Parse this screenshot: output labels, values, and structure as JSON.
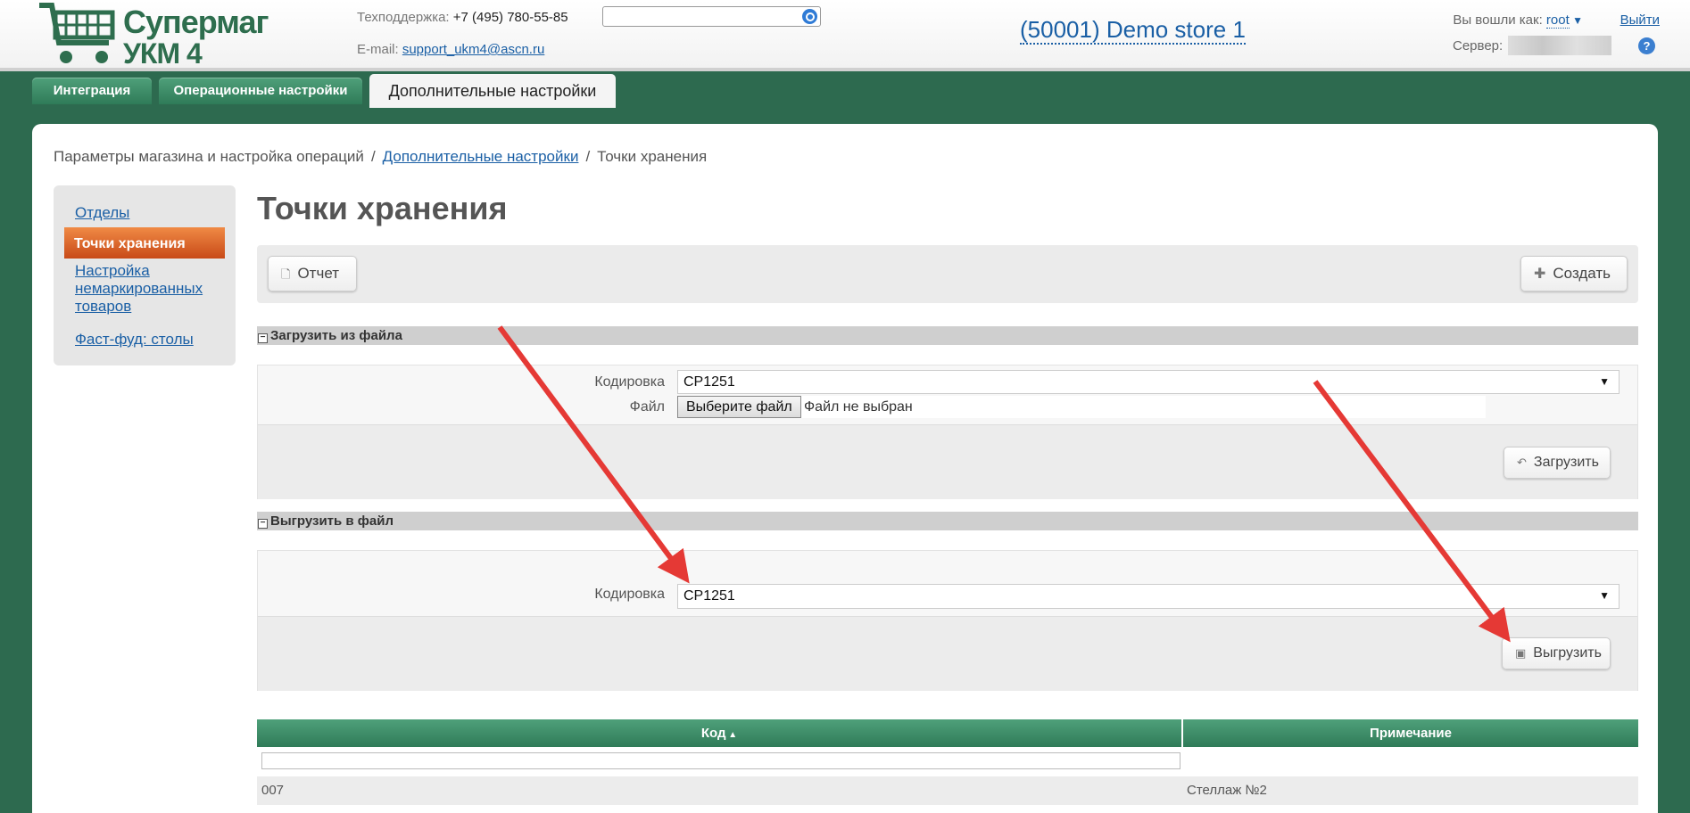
{
  "header": {
    "brand_line1": "Супермаг",
    "brand_line2": "УКМ 4",
    "support_label": "Техподдержка:",
    "support_phone": "+7 (495) 780-55-85",
    "email_label": "E-mail:",
    "email_value": "support_ukm4@ascn.ru",
    "search_value": "",
    "store_name": "(50001) Demo store 1",
    "logged_in_label": "Вы вошли как:",
    "user_name": "root",
    "logout_label": "Выйти",
    "server_label": "Сервер:",
    "help_label": "?"
  },
  "tabs": [
    {
      "label": "Интеграция"
    },
    {
      "label": "Операционные настройки"
    },
    {
      "label": "Дополнительные настройки"
    }
  ],
  "breadcrumb": {
    "root": "Параметры магазина и настройка операций",
    "sep": "/",
    "middle": "Дополнительные настройки",
    "current": "Точки хранения"
  },
  "sidebar": {
    "items": [
      {
        "label": "Отделы"
      },
      {
        "label": "Точки хранения"
      },
      {
        "label": "Настройка немаркированных товаров"
      },
      {
        "label": "Фаст-фуд: столы"
      }
    ]
  },
  "page": {
    "title": "Точки хранения",
    "report_label": "Отчет",
    "create_label": "Создать"
  },
  "import_section": {
    "title": "Загрузить из файла",
    "encoding_label": "Кодировка",
    "encoding_value": "CP1251",
    "file_label": "Файл",
    "choose_file_label": "Выберите файл",
    "no_file_label": "Файл не выбран",
    "upload_label": "Загрузить"
  },
  "export_section": {
    "title": "Выгрузить в файл",
    "encoding_label": "Кодировка",
    "encoding_value": "CP1251",
    "export_label": "Выгрузить"
  },
  "table": {
    "columns": [
      "Код",
      "Примечание"
    ],
    "rows": [
      {
        "code": "007",
        "note": "Стеллаж №2"
      }
    ]
  },
  "colors": {
    "brand_green": "#2e6e4e",
    "header_green": "#2f7b58",
    "active_orange": "#e06a2c",
    "link_blue": "#1a5fa5",
    "annotation_red": "#e53935"
  }
}
